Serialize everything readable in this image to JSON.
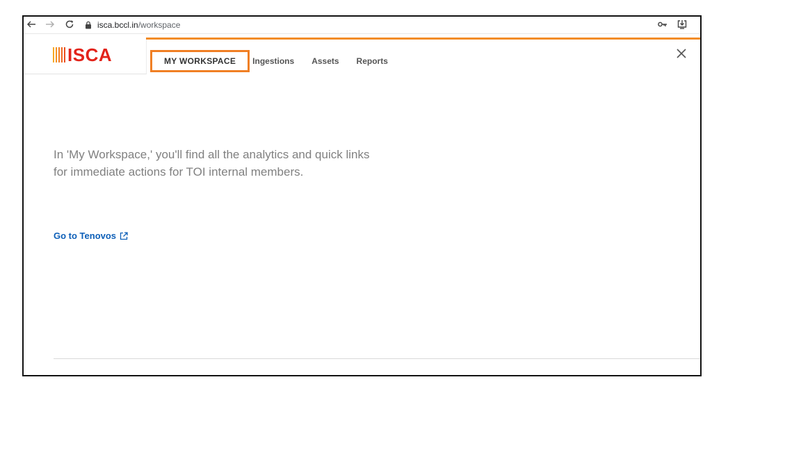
{
  "browser": {
    "url_host": "isca.bccl.in",
    "url_path": "/workspace",
    "icons": [
      "back-arrow-icon",
      "forward-arrow-icon",
      "reload-icon",
      "lock-icon",
      "key-icon",
      "install-app-icon"
    ]
  },
  "header": {
    "logo_text": "ISCA",
    "logo_colors": [
      "#f7a823",
      "#f59322",
      "#f27d21",
      "#ef6620",
      "#ec4f1f"
    ],
    "accent_color": "#f28c28",
    "tabs": [
      {
        "label": "MY WORKSPACE",
        "active": true
      },
      {
        "label": "Ingestions",
        "active": false
      },
      {
        "label": "Assets",
        "active": false
      },
      {
        "label": "Reports",
        "active": false
      }
    ]
  },
  "main": {
    "description": "In 'My Workspace,' you'll find all the analytics and quick links for immediate actions for TOI internal members.",
    "link_label": "Go to Tenovos",
    "link_color": "#0d5fb8"
  }
}
